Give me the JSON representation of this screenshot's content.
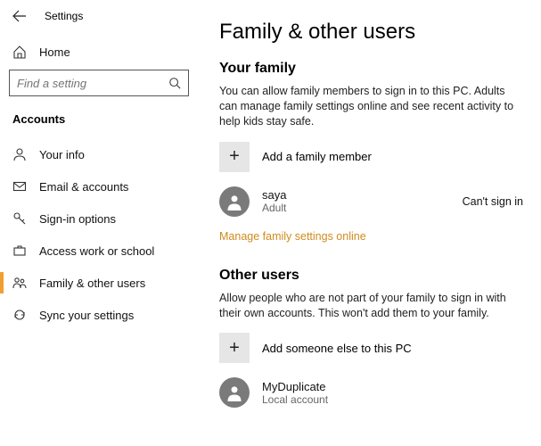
{
  "header": {
    "settings": "Settings"
  },
  "sidebar": {
    "home": "Home",
    "search_placeholder": "Find a setting",
    "section": "Accounts",
    "items": [
      {
        "label": "Your info"
      },
      {
        "label": "Email & accounts"
      },
      {
        "label": "Sign-in options"
      },
      {
        "label": "Access work or school"
      },
      {
        "label": "Family & other users"
      },
      {
        "label": "Sync your settings"
      }
    ]
  },
  "main": {
    "title": "Family & other users",
    "family": {
      "heading": "Your family",
      "desc": "You can allow family members to sign in to this PC. Adults can manage family settings online and see recent activity to help kids stay safe.",
      "add_label": "Add a family member",
      "member": {
        "name": "saya",
        "role": "Adult",
        "status": "Can't sign in"
      },
      "manage_link": "Manage family settings online"
    },
    "other": {
      "heading": "Other users",
      "desc": "Allow people who are not part of your family to sign in with their own accounts. This won't add them to your family.",
      "add_label": "Add someone else to this PC",
      "member": {
        "name": "MyDuplicate",
        "role": "Local account"
      }
    }
  }
}
